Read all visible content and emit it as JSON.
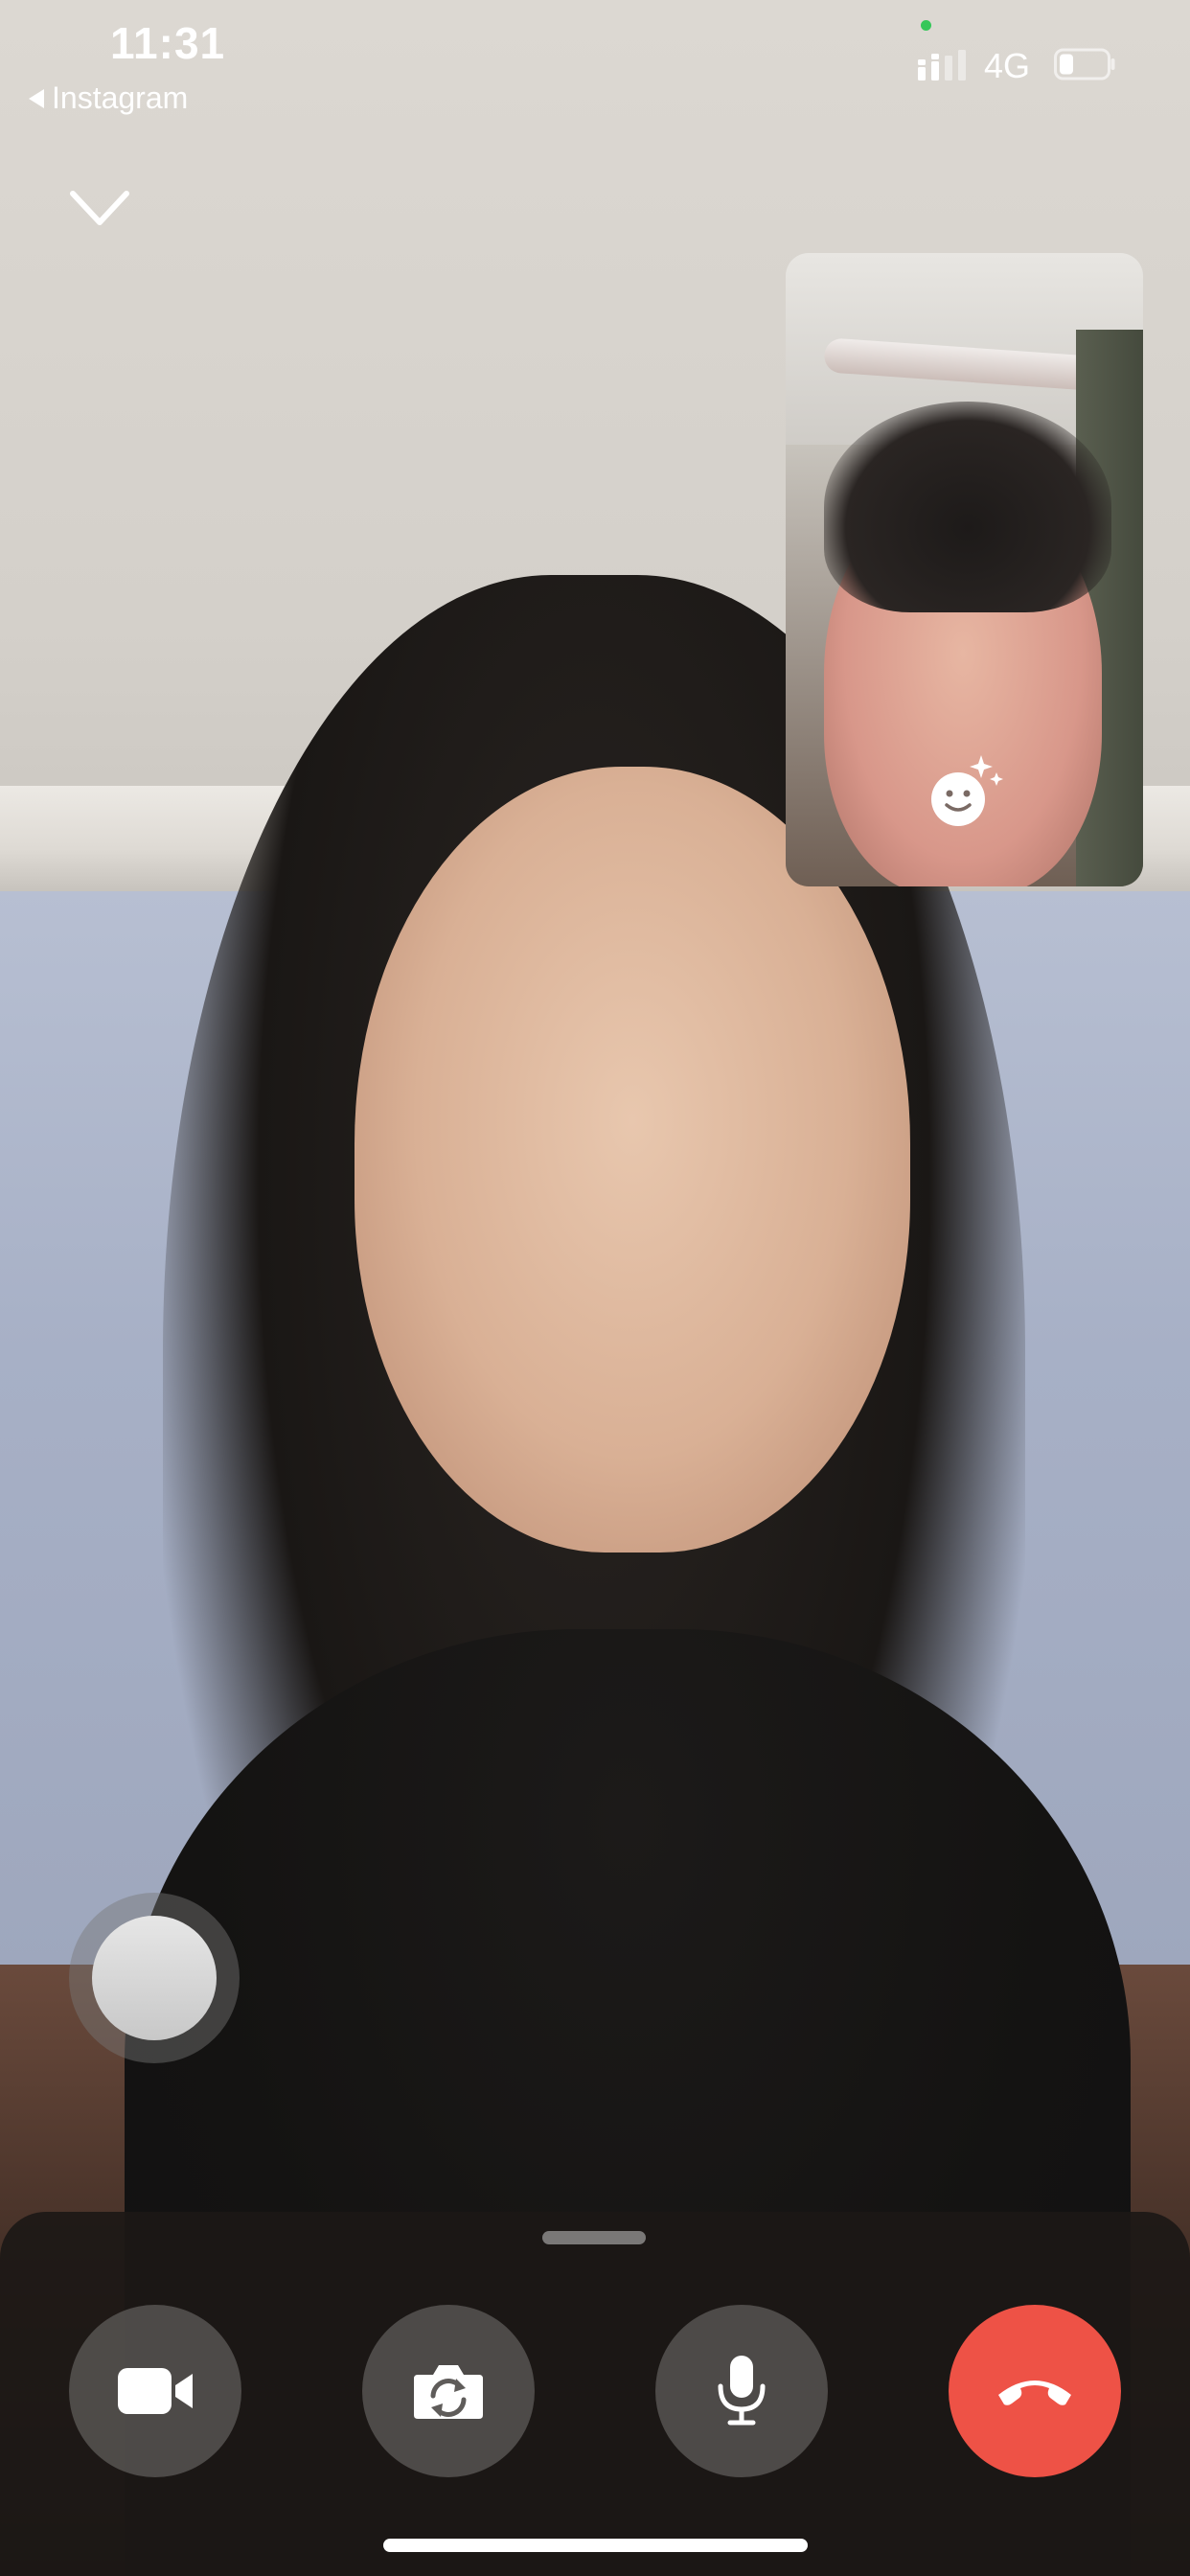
{
  "status_bar": {
    "time": "11:31",
    "back_app_label": "Instagram",
    "network": "4G",
    "mic_indicator_color": "#35c759",
    "battery_icon": "battery-low-icon",
    "signal_icon": "signal-bars-icon"
  },
  "call": {
    "collapse_icon": "chevron-down-icon",
    "self_view_effects_icon": "face-effects-icon"
  },
  "controls": {
    "video_icon": "video-camera-icon",
    "flip_icon": "camera-flip-icon",
    "mic_icon": "microphone-icon",
    "end_icon": "end-call-icon",
    "end_color": "#ee5246"
  }
}
